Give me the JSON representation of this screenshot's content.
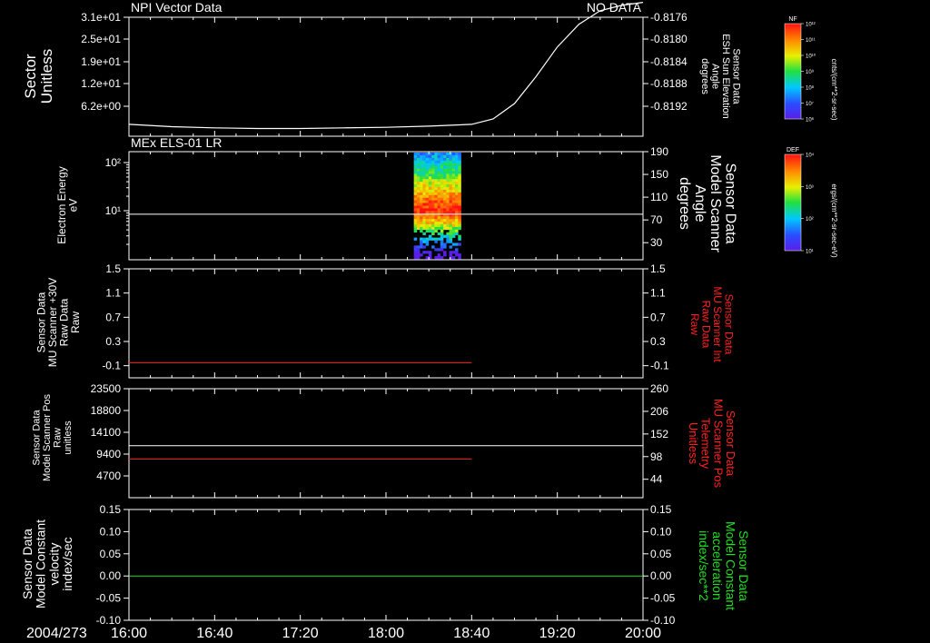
{
  "colors": {
    "background": "#000000",
    "axis": "#ffffff",
    "white_trace": "#ffffff",
    "red_trace": "#ff2020",
    "green_trace": "#20e020",
    "red_label": "#ff2020",
    "green_label": "#20e020"
  },
  "chart_data": [
    {
      "type": "line",
      "panel": "sector",
      "title": "NPI Vector Data",
      "title_right": "NO DATA",
      "ylabel_left": [
        "Sector",
        "Unitless"
      ],
      "yticks_left": [
        "3.1e+01",
        "2.5e+01",
        "1.9e+01",
        "1.2e+01",
        "6.2e+00"
      ],
      "ylabel_right": [
        "Sensor Data",
        "ESH Sun Elevation",
        "Angle",
        "degrees"
      ],
      "yticks_right": [
        "-0.8176",
        "-0.8180",
        "-0.8184",
        "-0.8188",
        "-0.8192"
      ],
      "ylim_right": [
        -0.8195,
        -0.8175
      ],
      "series": [
        {
          "axis": "right",
          "color": "white",
          "x": [
            "16:00",
            "16:20",
            "16:40",
            "17:00",
            "17:20",
            "17:40",
            "18:00",
            "18:20",
            "18:40",
            "18:50",
            "19:00",
            "19:10",
            "19:20",
            "19:30",
            "19:40",
            "19:50",
            "20:00"
          ],
          "values": [
            -0.8193,
            -0.81934,
            -0.81936,
            -0.81937,
            -0.81937,
            -0.81936,
            -0.81935,
            -0.81933,
            -0.8193,
            -0.81921,
            -0.81895,
            -0.8185,
            -0.818,
            -0.81762,
            -0.81739,
            -0.8173,
            -0.81725
          ]
        }
      ]
    },
    {
      "type": "heatmap",
      "panel": "els",
      "title": "MEx ELS-01 LR",
      "ylabel_left": [
        "Electron Energy",
        "eV"
      ],
      "yticks_left": [
        "10²",
        "10¹"
      ],
      "ylabel_right": [
        "Sensor Data",
        "Model Scanner",
        "Angle",
        "degrees"
      ],
      "yticks_right": [
        "190",
        "150",
        "110",
        "70",
        "30"
      ],
      "ylim_right": [
        0,
        190
      ],
      "data_x_range": [
        "18:00",
        "18:40"
      ],
      "scanner_angle_level": 80
    },
    {
      "type": "line",
      "panel": "scanner-int",
      "ylabel_left": [
        "Sensor Data",
        "MU Scanner +30V",
        "Raw Data",
        "Raw"
      ],
      "yticks_left": [
        "1.5",
        "1.1",
        "0.7",
        "0.3",
        "-0.1"
      ],
      "ylabel_right": [
        "Sensor Data",
        "MU Scanner Int",
        "Raw Data",
        "Raw"
      ],
      "yticks_right": [
        "1.5",
        "1.1",
        "0.7",
        "0.3",
        "-0.1"
      ],
      "ylim": [
        -0.3,
        1.5
      ],
      "series": [
        {
          "color": "red",
          "x_range": [
            "16:00",
            "18:40"
          ],
          "value": -0.05
        }
      ]
    },
    {
      "type": "line",
      "panel": "scanner-pos",
      "ylabel_left": [
        "Sensor Data",
        "Model Scanner Pos",
        "Raw",
        "unitless"
      ],
      "yticks_left": [
        "23500",
        "18800",
        "14100",
        "9400",
        "4700"
      ],
      "ylim_left": [
        0,
        23500
      ],
      "ylabel_right": [
        "Sensor Data",
        "MU Scanner Pos",
        "Telemetry",
        "Unitless"
      ],
      "yticks_right": [
        "260",
        "206",
        "152",
        "98",
        "44"
      ],
      "ylim_right": [
        0,
        260
      ],
      "series": [
        {
          "axis": "left",
          "color": "white",
          "x_range": [
            "16:00",
            "20:00"
          ],
          "value": 11200
        },
        {
          "axis": "left",
          "color": "red",
          "x_range": [
            "16:00",
            "18:40"
          ],
          "value": 8350
        }
      ]
    },
    {
      "type": "line",
      "panel": "constants",
      "ylabel_left": [
        "Sensor Data",
        "Model Constant",
        "velocity",
        "index/sec"
      ],
      "yticks_left": [
        "0.15",
        "0.10",
        "0.05",
        "0.00",
        "-0.05",
        "-0.10"
      ],
      "ylim": [
        -0.1,
        0.15
      ],
      "ylabel_right": [
        "Sensor Data",
        "Model Constant",
        "acceleration",
        "index/sec**2"
      ],
      "yticks_right": [
        "0.15",
        "0.10",
        "0.05",
        "0.00",
        "-0.05",
        "-0.10"
      ],
      "series": [
        {
          "color": "green",
          "x_range": [
            "16:00",
            "20:00"
          ],
          "value": 0.0
        }
      ]
    }
  ],
  "time_axis": {
    "date": "2004/273",
    "ticks": [
      "16:00",
      "16:40",
      "17:20",
      "18:00",
      "18:40",
      "19:20",
      "20:00"
    ]
  },
  "colorbars": [
    {
      "name": "NF",
      "ticks": [
        "10¹²",
        "10¹¹",
        "10¹⁰",
        "10⁹",
        "10⁸",
        "10⁷",
        "10⁶"
      ],
      "unit": "cnts/(cm**2-sr-sec)"
    },
    {
      "name": "DEF",
      "ticks": [
        "10⁴",
        "10³",
        "10²",
        "10¹"
      ],
      "unit": "ergs/(cm**2-sr-sec-eV)"
    }
  ]
}
